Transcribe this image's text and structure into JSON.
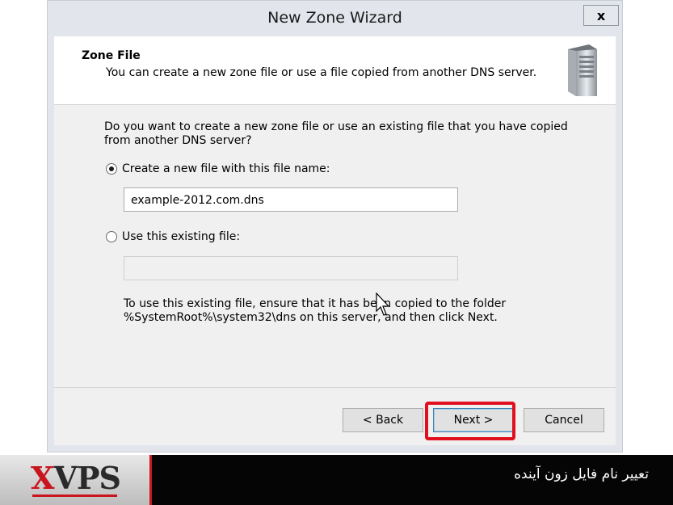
{
  "window": {
    "title": "New Zone Wizard",
    "close_label": "x"
  },
  "header": {
    "title": "Zone File",
    "subtitle": "You can create a new zone file or use a file copied from another DNS server."
  },
  "body": {
    "question_line1": "Do you want to create a new zone file or use an existing file that you have copied",
    "question_line2": "from another DNS server?",
    "option_new_label": "Create a new file with this file name:",
    "option_new_selected": true,
    "new_file_value": "example-2012.com.dns",
    "option_existing_label": "Use this existing file:",
    "option_existing_selected": false,
    "existing_file_value": "",
    "note_line1": "To use this existing file, ensure that it has been copied to the folder",
    "note_line2": "%SystemRoot%\\system32\\dns on this server, and then click Next."
  },
  "buttons": {
    "back": "< Back",
    "next": "Next >",
    "cancel": "Cancel"
  },
  "banner": {
    "logo_x": "X",
    "logo_vps": "VPS",
    "caption": "تعییر نام فایل زون آینده"
  },
  "colors": {
    "highlight": "#e0101e",
    "brand_red": "#c9161e"
  }
}
